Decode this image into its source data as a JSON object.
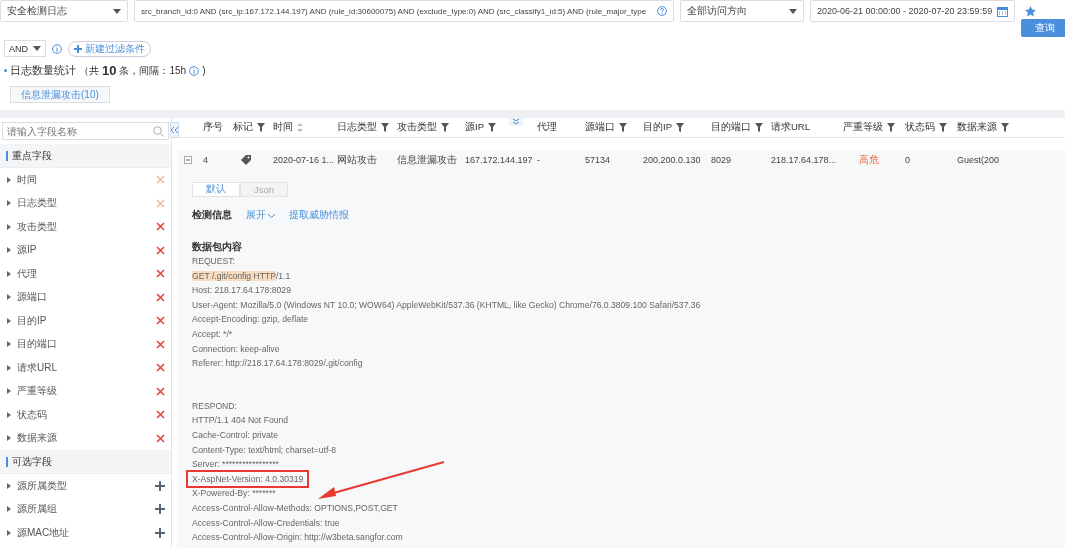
{
  "toolbar": {
    "log_type": "安全检测日志",
    "query": "src_branch_id:0 AND (src_ip:167.172.144.197) AND (rule_id:30600075) AND (exclude_type:0) AND (src_classify1_id:5) AND (rule_major_type",
    "direction": "全部访问方向",
    "date_range": "2020-06-21 00:00:00 - 2020-07-20 23:59:59",
    "search_button": "查询"
  },
  "filter": {
    "operator": "AND",
    "add_button": "新建过滤条件"
  },
  "stats": {
    "label": "日志数量统计",
    "prefix": "（共",
    "count": "10",
    "suffix": "条，间隔：15h",
    "close": ")"
  },
  "tags": [
    {
      "label": "信息泄漏攻击(10)",
      "selected": false
    }
  ],
  "sidebar": {
    "search": {
      "placeholder": "请输入字段名称"
    },
    "sections": [
      {
        "title": "重点字段",
        "kind": "key",
        "items": [
          {
            "label": "时间",
            "disabled": true
          },
          {
            "label": "日志类型",
            "disabled": true
          },
          {
            "label": "攻击类型",
            "disabled": false
          },
          {
            "label": "源IP",
            "disabled": false
          },
          {
            "label": "代理",
            "disabled": false
          },
          {
            "label": "源端口",
            "disabled": false
          },
          {
            "label": "目的IP",
            "disabled": false
          },
          {
            "label": "目的端口",
            "disabled": false
          },
          {
            "label": "请求URL",
            "disabled": false
          },
          {
            "label": "严重等级",
            "disabled": false
          },
          {
            "label": "状态码",
            "disabled": false
          },
          {
            "label": "数据来源",
            "disabled": false
          }
        ]
      },
      {
        "title": "可选字段",
        "kind": "optional",
        "items": [
          {
            "label": "源所属类型",
            "disabled": false
          },
          {
            "label": "源所属组",
            "disabled": false
          },
          {
            "label": "源MAC地址",
            "disabled": false
          }
        ]
      }
    ]
  },
  "table": {
    "columns": [
      {
        "label": "序号",
        "kind": "plain"
      },
      {
        "label": "标记",
        "kind": "filter"
      },
      {
        "label": "时间",
        "kind": "sort"
      },
      {
        "label": "日志类型",
        "kind": "filter"
      },
      {
        "label": "攻击类型",
        "kind": "filter"
      },
      {
        "label": "源IP",
        "kind": "filter"
      },
      {
        "label": "代理",
        "kind": "plain"
      },
      {
        "label": "源端口",
        "kind": "filter"
      },
      {
        "label": "目的IP",
        "kind": "filter"
      },
      {
        "label": "目的端口",
        "kind": "filter"
      },
      {
        "label": "请求URL",
        "kind": "plain"
      },
      {
        "label": "严重等级",
        "kind": "filter"
      },
      {
        "label": "状态码",
        "kind": "filter"
      },
      {
        "label": "数据来源",
        "kind": "filter"
      }
    ],
    "rows": [
      {
        "expanded": true,
        "index": "4",
        "time": "2020-07-16 1...",
        "log_type": "网站攻击",
        "attack_type": "信息泄漏攻击",
        "src_ip": "167.172.144.197",
        "proxy": "-",
        "src_port": "57134",
        "dst_ip": "200.200.0.130",
        "dst_port": "8029",
        "url": "218.17.64.178...",
        "severity": "高危",
        "status": "0",
        "source": "Guest(200"
      }
    ]
  },
  "detail": {
    "view_tabs": [
      {
        "label": "默认",
        "selected": true
      },
      {
        "label": "Json",
        "selected": false
      }
    ],
    "section_label": "检测信息",
    "expand_link": "展开",
    "intel_link": "提取威胁情报",
    "content_title": "数据包内容",
    "request": [
      {
        "text": "REQUEST:"
      },
      {
        "highlight": "GET /.git/config HTTP",
        "text": "/1.1"
      },
      {
        "text": "Host: 218.17.64.178:8029"
      },
      {
        "text": "User-Agent: Mozilla/5.0 (Windows NT 10.0; WOW64) AppleWebKit/537.36 (KHTML, like Gecko) Chrome/76.0.3809.100 Safari/537.36"
      },
      {
        "text": "Accept-Encoding: gzip, deflate"
      },
      {
        "text": "Accept: */*"
      },
      {
        "text": "Connection: keep-alive"
      },
      {
        "text": "Referer: http://218.17.64.178:8029/.git/config"
      }
    ],
    "response": [
      {
        "text": "RESPOND:",
        "marked": false
      },
      {
        "text": "HTTP/1.1 404 Not Found",
        "marked": false
      },
      {
        "text": "Cache-Control: private",
        "marked": false
      },
      {
        "text": "Content-Type: text/html; charset=utf-8",
        "marked": false
      },
      {
        "text": "Server: *****************",
        "marked": false
      },
      {
        "text": "X-AspNet-Version: 4.0.30319",
        "marked": true
      },
      {
        "text": "X-Powered-By: *******",
        "marked": false
      },
      {
        "text": "Access-Control-Allow-Methods: OPTIONS,POST,GET",
        "marked": false
      },
      {
        "text": "Access-Control-Allow-Credentials: true",
        "marked": false
      },
      {
        "text": "Access-Control-Allow-Origin: http://w3beta.sangfor.com",
        "marked": false
      }
    ]
  }
}
